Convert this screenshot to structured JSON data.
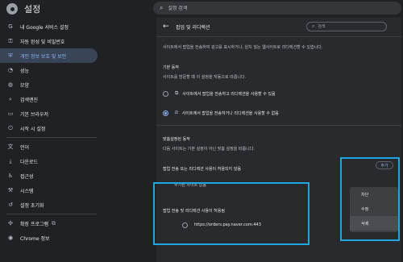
{
  "app": {
    "title": "설정"
  },
  "search": {
    "placeholder": "설정 검색"
  },
  "sidebar": {
    "items": [
      {
        "label": "내 Google 서비스 설정",
        "icon": "google-icon"
      },
      {
        "label": "자동 완성 및 비밀번호",
        "icon": "key-icon"
      },
      {
        "label": "개인 정보 보호 및 보안",
        "icon": "shield-icon",
        "active": true
      },
      {
        "label": "성능",
        "icon": "speedometer-icon"
      },
      {
        "label": "모양",
        "icon": "palette-icon"
      },
      {
        "label": "검색엔진",
        "icon": "search-icon"
      },
      {
        "label": "기본 브라우저",
        "icon": "browser-icon"
      },
      {
        "label": "시작 시 설정",
        "icon": "power-icon"
      }
    ],
    "items2": [
      {
        "label": "언어",
        "icon": "language-icon"
      },
      {
        "label": "다운로드",
        "icon": "download-icon"
      },
      {
        "label": "접근성",
        "icon": "accessibility-icon"
      },
      {
        "label": "시스템",
        "icon": "wrench-icon"
      },
      {
        "label": "설정 초기화",
        "icon": "reset-icon"
      }
    ],
    "items3": [
      {
        "label": "확장 프로그램",
        "icon": "puzzle-icon"
      },
      {
        "label": "Chrome 정보",
        "icon": "chrome-icon"
      }
    ]
  },
  "page": {
    "title": "팝업 및 리디렉션",
    "search_placeholder": "검색",
    "description": "사이트에서 팝업을 전송하여 광고를 표시하거나, 원치 않는 웹사이트로 리디렉션할 수 있습니다.",
    "default_heading": "기본 동작",
    "default_sub": "사이트를 방문할 때 이 설정을 자동으로 따릅니다.",
    "option_allow": "사이트에서 팝업을 전송하고 리디렉션을 사용할 수 있음",
    "option_block": "사이트에서 팝업을 전송하거나 리디렉션을 사용할 수 없음",
    "custom_heading": "맞춤설정된 동작",
    "custom_sub": "다음 사이트는 기본 설정이 아닌 맞춤 설정을 따릅니다.",
    "blocked_heading": "팝업 전송 또는 리디렉션 사용이 허용되지 않음",
    "add_label": "추가",
    "no_sites": "추가된 사이트 없음",
    "allowed_heading": "팝업 전송 및 리디렉션 사용이 허용됨",
    "allowed_site": "https://orders.pay.naver.com:443"
  },
  "context_menu": {
    "items": [
      "차단",
      "수정",
      "삭제"
    ]
  },
  "colors": {
    "highlight": "#1ea7e1",
    "accent": "#8ab4f8",
    "active_bg": "#394457"
  }
}
